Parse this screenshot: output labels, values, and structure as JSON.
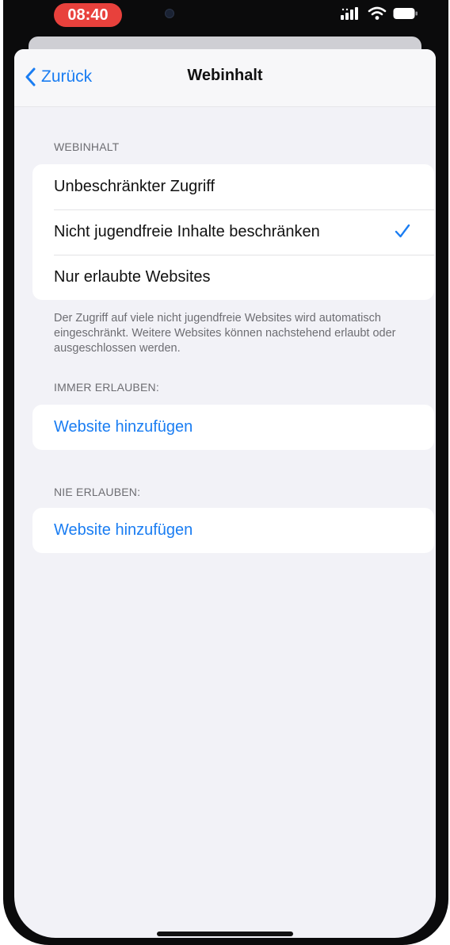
{
  "status_bar": {
    "time": "08:40",
    "icons": [
      "signal-icon",
      "wifi-icon",
      "battery-icon"
    ]
  },
  "nav": {
    "back_label": "Zurück",
    "title": "Webinhalt"
  },
  "webinhalt_section": {
    "header": "WEBINHALT",
    "options": [
      {
        "label": "Unbeschränkter Zugriff",
        "selected": false
      },
      {
        "label": "Nicht jugendfreie Inhalte beschränken",
        "selected": true
      },
      {
        "label": "Nur erlaubte Websites",
        "selected": false
      }
    ],
    "footnote": "Der Zugriff auf viele nicht jugendfreie Websites wird automatisch eingeschränkt. Weitere Websites können nachstehend erlaubt oder ausgeschlossen werden."
  },
  "always_allow_section": {
    "header": "IMMER ERLAUBEN:",
    "add_label": "Website hinzufügen"
  },
  "never_allow_section": {
    "header": "NIE ERLAUBEN:",
    "add_label": "Website hinzufügen"
  },
  "colors": {
    "accent": "#1a7df2",
    "recording_pill": "#e8413c",
    "background": "#f2f2f7"
  }
}
